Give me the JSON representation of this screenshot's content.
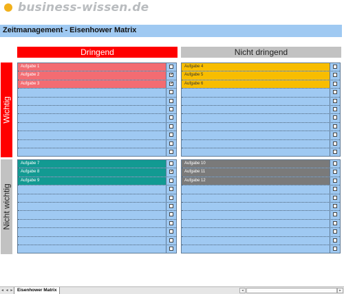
{
  "logo": {
    "text": "business-wissen.de"
  },
  "title": "Zeitmanagement - Eisenhower Matrix",
  "headers": {
    "dringend": "Dringend",
    "nicht_dringend": "Nicht dringend"
  },
  "side_labels": {
    "wichtig": "Wichtig",
    "nicht_wichtig": "Nicht wichtig"
  },
  "quadrants": [
    {
      "id": "q1",
      "color": "#f36c72",
      "text_color": "#ffffff",
      "rows": [
        {
          "text": "Aufgabe 1",
          "checked": false
        },
        {
          "text": "Aufgabe 2",
          "checked": true
        },
        {
          "text": "Aufgabe 3",
          "checked": true
        }
      ]
    },
    {
      "id": "q2",
      "color": "#f8bd00",
      "text_color": "#333333",
      "rows": [
        {
          "text": "Aufgabe 4",
          "checked": false
        },
        {
          "text": "Aufgabe 5",
          "checked": false
        },
        {
          "text": "Aufgabe 6",
          "checked": false
        }
      ]
    },
    {
      "id": "q3",
      "color": "#129a92",
      "text_color": "#ffffff",
      "rows": [
        {
          "text": "Aufgabe 7",
          "checked": false
        },
        {
          "text": "Aufgabe 8",
          "checked": true
        },
        {
          "text": "Aufgabe 9",
          "checked": false
        }
      ]
    },
    {
      "id": "q4",
      "color": "#7a7a7a",
      "text_color": "#ffffff",
      "rows": [
        {
          "text": "Aufgabe 10",
          "checked": false
        },
        {
          "text": "Aufgabe 11",
          "checked": false
        },
        {
          "text": "Aufgabe 12",
          "checked": false
        }
      ]
    }
  ],
  "rows_per_quadrant": 11,
  "check_mark": "✓",
  "sheet_tab": "Eisenhower Matrix",
  "nav_arrows": "◂ ◂ ▸ ▸",
  "scroll_left": "◂",
  "scroll_right": "▸"
}
